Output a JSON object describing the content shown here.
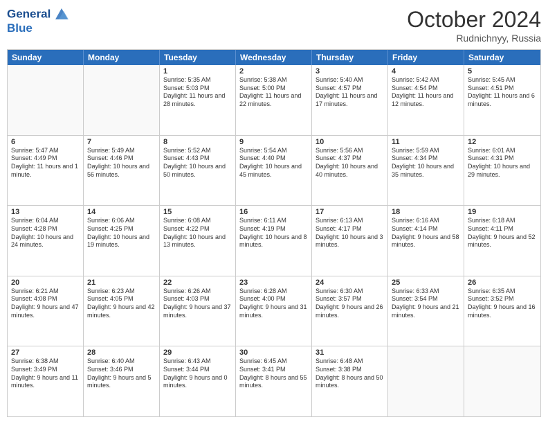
{
  "header": {
    "logo_line1": "General",
    "logo_line2": "Blue",
    "month": "October 2024",
    "location": "Rudnichnyy, Russia"
  },
  "days": [
    "Sunday",
    "Monday",
    "Tuesday",
    "Wednesday",
    "Thursday",
    "Friday",
    "Saturday"
  ],
  "weeks": [
    [
      {
        "day": "",
        "empty": true
      },
      {
        "day": "",
        "empty": true
      },
      {
        "day": "1",
        "rise": "5:35 AM",
        "set": "5:03 PM",
        "daylight": "11 hours and 28 minutes."
      },
      {
        "day": "2",
        "rise": "5:38 AM",
        "set": "5:00 PM",
        "daylight": "11 hours and 22 minutes."
      },
      {
        "day": "3",
        "rise": "5:40 AM",
        "set": "4:57 PM",
        "daylight": "11 hours and 17 minutes."
      },
      {
        "day": "4",
        "rise": "5:42 AM",
        "set": "4:54 PM",
        "daylight": "11 hours and 12 minutes."
      },
      {
        "day": "5",
        "rise": "5:45 AM",
        "set": "4:51 PM",
        "daylight": "11 hours and 6 minutes."
      }
    ],
    [
      {
        "day": "6",
        "rise": "5:47 AM",
        "set": "4:49 PM",
        "daylight": "11 hours and 1 minute."
      },
      {
        "day": "7",
        "rise": "5:49 AM",
        "set": "4:46 PM",
        "daylight": "10 hours and 56 minutes."
      },
      {
        "day": "8",
        "rise": "5:52 AM",
        "set": "4:43 PM",
        "daylight": "10 hours and 50 minutes."
      },
      {
        "day": "9",
        "rise": "5:54 AM",
        "set": "4:40 PM",
        "daylight": "10 hours and 45 minutes."
      },
      {
        "day": "10",
        "rise": "5:56 AM",
        "set": "4:37 PM",
        "daylight": "10 hours and 40 minutes."
      },
      {
        "day": "11",
        "rise": "5:59 AM",
        "set": "4:34 PM",
        "daylight": "10 hours and 35 minutes."
      },
      {
        "day": "12",
        "rise": "6:01 AM",
        "set": "4:31 PM",
        "daylight": "10 hours and 29 minutes."
      }
    ],
    [
      {
        "day": "13",
        "rise": "6:04 AM",
        "set": "4:28 PM",
        "daylight": "10 hours and 24 minutes."
      },
      {
        "day": "14",
        "rise": "6:06 AM",
        "set": "4:25 PM",
        "daylight": "10 hours and 19 minutes."
      },
      {
        "day": "15",
        "rise": "6:08 AM",
        "set": "4:22 PM",
        "daylight": "10 hours and 13 minutes."
      },
      {
        "day": "16",
        "rise": "6:11 AM",
        "set": "4:19 PM",
        "daylight": "10 hours and 8 minutes."
      },
      {
        "day": "17",
        "rise": "6:13 AM",
        "set": "4:17 PM",
        "daylight": "10 hours and 3 minutes."
      },
      {
        "day": "18",
        "rise": "6:16 AM",
        "set": "4:14 PM",
        "daylight": "9 hours and 58 minutes."
      },
      {
        "day": "19",
        "rise": "6:18 AM",
        "set": "4:11 PM",
        "daylight": "9 hours and 52 minutes."
      }
    ],
    [
      {
        "day": "20",
        "rise": "6:21 AM",
        "set": "4:08 PM",
        "daylight": "9 hours and 47 minutes."
      },
      {
        "day": "21",
        "rise": "6:23 AM",
        "set": "4:05 PM",
        "daylight": "9 hours and 42 minutes."
      },
      {
        "day": "22",
        "rise": "6:26 AM",
        "set": "4:03 PM",
        "daylight": "9 hours and 37 minutes."
      },
      {
        "day": "23",
        "rise": "6:28 AM",
        "set": "4:00 PM",
        "daylight": "9 hours and 31 minutes."
      },
      {
        "day": "24",
        "rise": "6:30 AM",
        "set": "3:57 PM",
        "daylight": "9 hours and 26 minutes."
      },
      {
        "day": "25",
        "rise": "6:33 AM",
        "set": "3:54 PM",
        "daylight": "9 hours and 21 minutes."
      },
      {
        "day": "26",
        "rise": "6:35 AM",
        "set": "3:52 PM",
        "daylight": "9 hours and 16 minutes."
      }
    ],
    [
      {
        "day": "27",
        "rise": "6:38 AM",
        "set": "3:49 PM",
        "daylight": "9 hours and 11 minutes."
      },
      {
        "day": "28",
        "rise": "6:40 AM",
        "set": "3:46 PM",
        "daylight": "9 hours and 5 minutes."
      },
      {
        "day": "29",
        "rise": "6:43 AM",
        "set": "3:44 PM",
        "daylight": "9 hours and 0 minutes."
      },
      {
        "day": "30",
        "rise": "6:45 AM",
        "set": "3:41 PM",
        "daylight": "8 hours and 55 minutes."
      },
      {
        "day": "31",
        "rise": "6:48 AM",
        "set": "3:38 PM",
        "daylight": "8 hours and 50 minutes."
      },
      {
        "day": "",
        "empty": true
      },
      {
        "day": "",
        "empty": true
      }
    ]
  ]
}
